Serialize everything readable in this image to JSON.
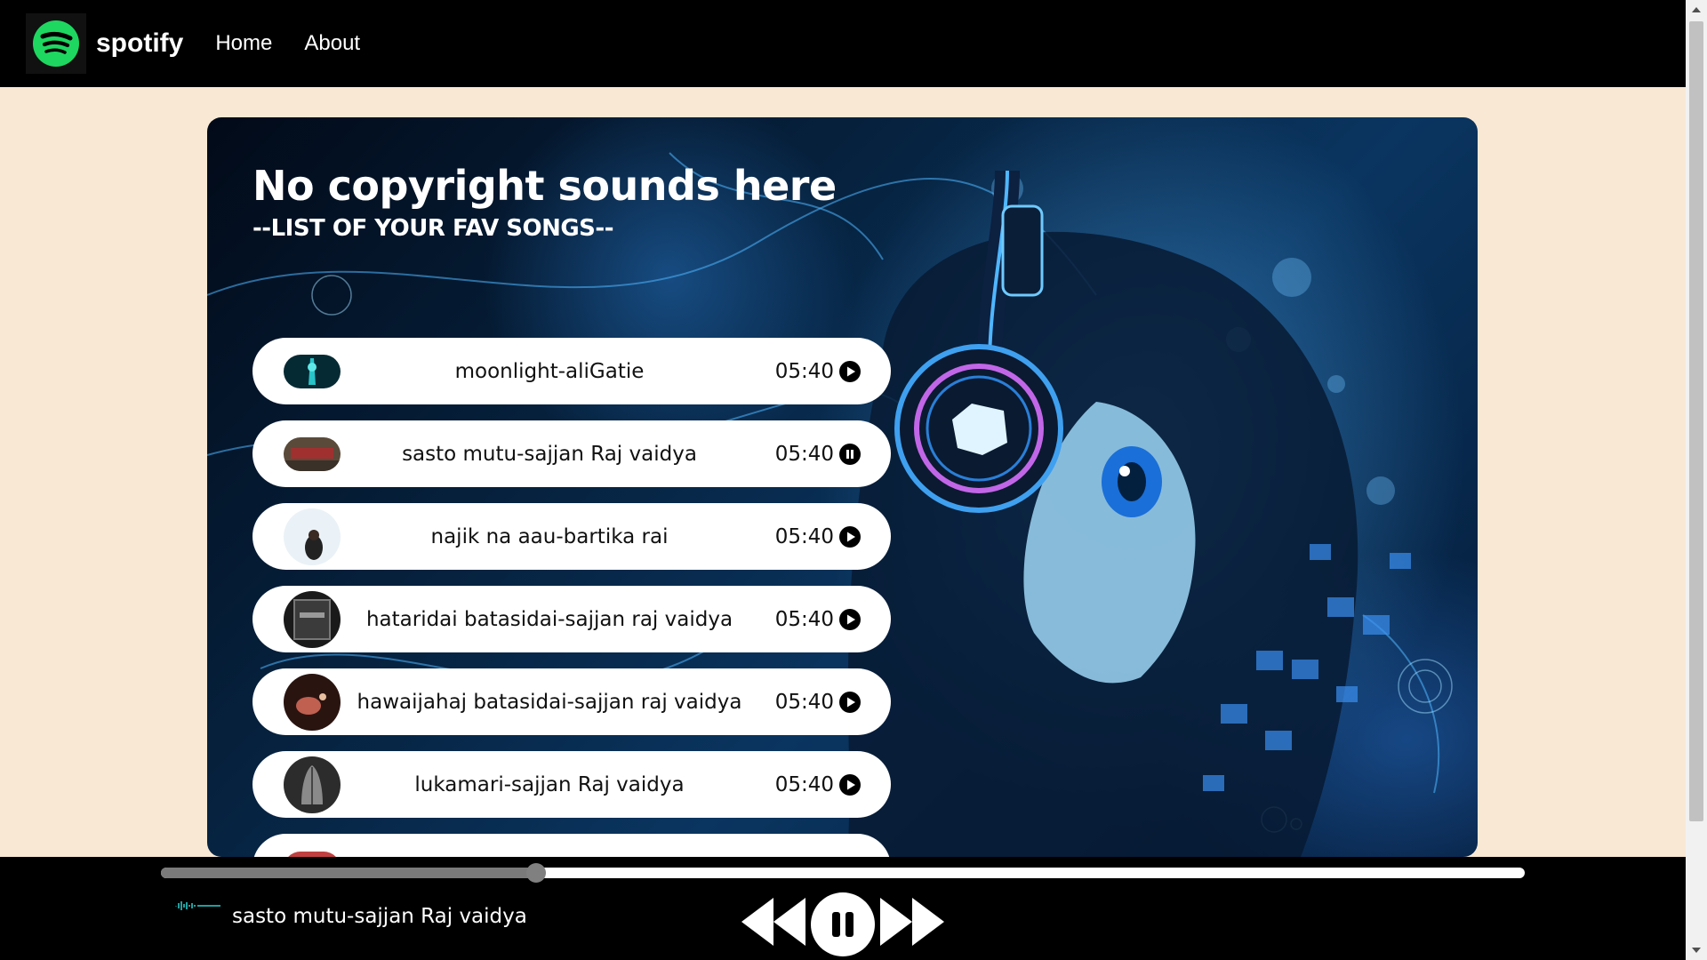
{
  "navbar": {
    "brand": "spotify",
    "links": [
      {
        "label": "Home"
      },
      {
        "label": "About"
      }
    ],
    "logo_icon": "spotify-logo-icon",
    "logo_color": "#1ed760"
  },
  "hero": {
    "title": "No copyright sounds here",
    "subtitle": "--LIST OF YOUR FAV SONGS--"
  },
  "songs": [
    {
      "name": "moonlight-aliGatie",
      "duration": "05:40",
      "state_icon": "play-circle-icon"
    },
    {
      "name": "sasto mutu-sajjan Raj vaidya",
      "duration": "05:40",
      "state_icon": "pause-circle-icon"
    },
    {
      "name": "najik na aau-bartika rai",
      "duration": "05:40",
      "state_icon": "play-circle-icon"
    },
    {
      "name": "hataridai batasidai-sajjan raj vaidya",
      "duration": "05:40",
      "state_icon": "play-circle-icon"
    },
    {
      "name": "hawaijahaj batasidai-sajjan raj vaidya",
      "duration": "05:40",
      "state_icon": "play-circle-icon"
    },
    {
      "name": "lukamari-sajjan Raj vaidya",
      "duration": "05:40",
      "state_icon": "play-circle-icon"
    }
  ],
  "player": {
    "now_playing": "sasto mutu-sajjan Raj vaidya",
    "progress_fraction": 0.275,
    "controls": [
      "previous-icon",
      "pause-icon",
      "next-icon"
    ]
  },
  "colors": {
    "page_background": "#f9e8d4",
    "nav_background": "#000000",
    "accent_green": "#1ed760",
    "wave_cyan": "#2bd4d4"
  }
}
